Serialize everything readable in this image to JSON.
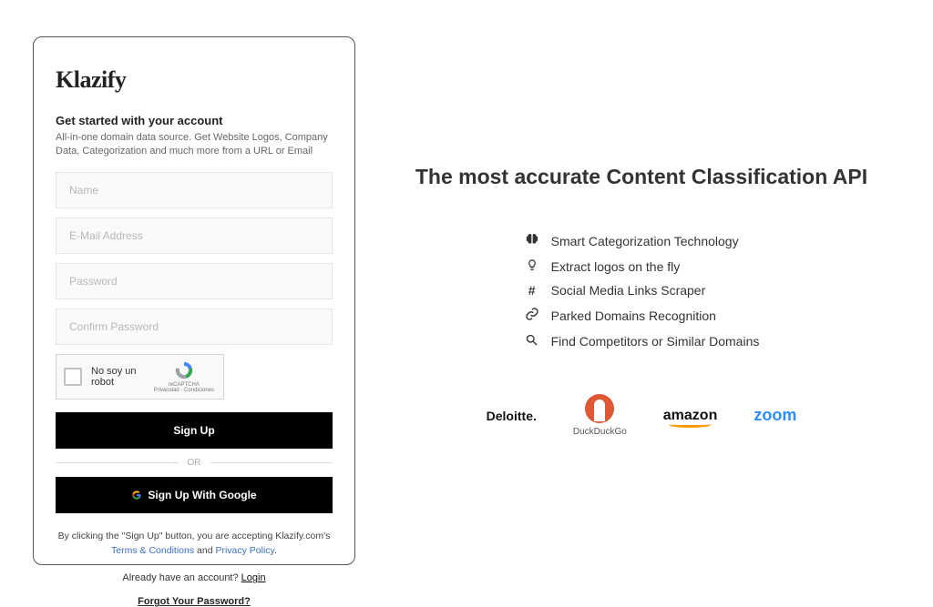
{
  "brand": "Klazify",
  "form": {
    "headline": "Get started with your account",
    "subtext": "All-in-one domain data source. Get Website Logos, Company Data, Categorization and much more from a URL or Email",
    "name_placeholder": "Name",
    "email_placeholder": "E-Mail Address",
    "password_placeholder": "Password",
    "confirm_placeholder": "Confirm Password",
    "recaptcha_label": "No soy un robot",
    "recaptcha_brand": "reCAPTCHA",
    "recaptcha_legal": "Privacidad - Condiciones",
    "signup_label": "Sign Up",
    "or_label": "OR",
    "google_label": "Sign Up With Google",
    "legal_prefix": "By clicking the \"Sign Up\" button, you are accepting Klazify.com's ",
    "terms_label": "Terms & Conditions",
    "legal_and": " and ",
    "privacy_label": "Privacy Policy",
    "legal_period": ".",
    "already_text": "Already have an account? ",
    "login_label": "Login",
    "forgot_label": "Forgot Your Password?"
  },
  "marketing": {
    "hero": "The most accurate Content Classification API",
    "features": [
      {
        "icon": "brain-icon",
        "label": "Smart Categorization Technology"
      },
      {
        "icon": "bulb-icon",
        "label": "Extract logos on the fly"
      },
      {
        "icon": "hash-icon",
        "label": "Social Media Links Scraper"
      },
      {
        "icon": "link-icon",
        "label": "Parked Domains Recognition"
      },
      {
        "icon": "search-icon",
        "label": "Find Competitors or Similar Domains"
      }
    ],
    "logos": {
      "deloitte": "Deloitte.",
      "duckduckgo": "DuckDuckGo",
      "amazon": "amazon",
      "zoom": "zoom"
    }
  }
}
